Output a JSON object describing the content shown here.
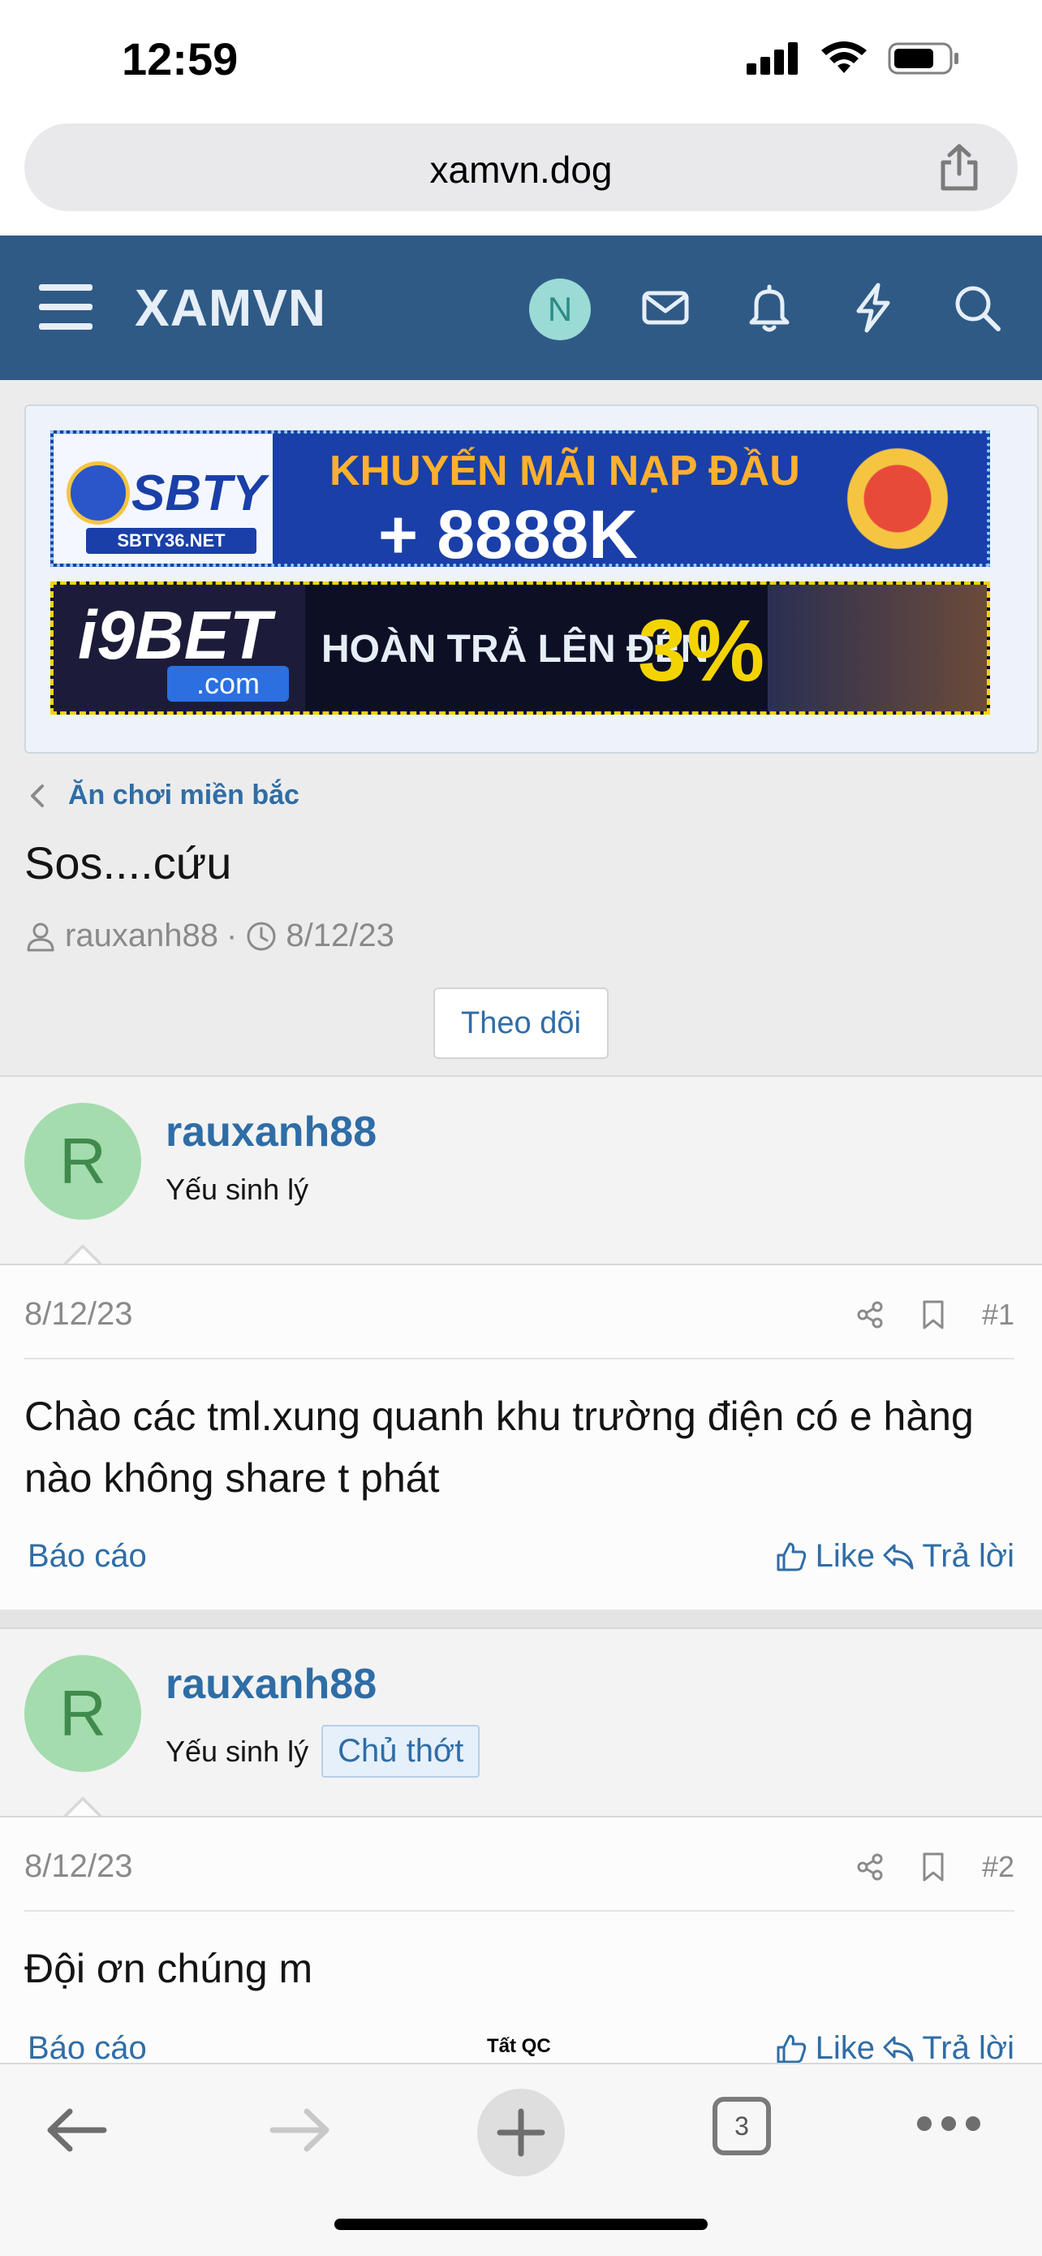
{
  "status_bar": {
    "time": "12:59"
  },
  "browser": {
    "url": "xamvn.dog"
  },
  "site_header": {
    "logo": "XAMVN",
    "user_initial": "N"
  },
  "ads": [
    {
      "brand": "SBTY",
      "brand_sub": "SBTY36.NET",
      "line1": "KHUYẾN MÃI NẠP ĐẦU",
      "line2": "+ 8888K"
    },
    {
      "brand": "i9BET",
      "brand_sub": ".com",
      "line1": "HOÀN TRẢ LÊN ĐẾN",
      "line2": "3%"
    }
  ],
  "breadcrumb": {
    "label": "Ăn chơi miền bắc"
  },
  "thread": {
    "title": "Sos....cứu",
    "author": "rauxanh88",
    "separator": "·",
    "date": "8/12/23",
    "follow_label": "Theo dõi"
  },
  "posts": [
    {
      "avatar_letter": "R",
      "username": "rauxanh88",
      "rank": "Yếu sinh lý",
      "date": "8/12/23",
      "number": "#1",
      "text": "Chào các tml.xung quanh khu trường điện có e hàng nào không share t phát",
      "report_label": "Báo cáo",
      "like_label": "Like",
      "reply_label": "Trả lời"
    },
    {
      "avatar_letter": "R",
      "username": "rauxanh88",
      "rank": "Yếu sinh lý",
      "badge": "Chủ thớt",
      "date": "8/12/23",
      "number": "#2",
      "text": "Đội ơn chúng m",
      "report_label": "Báo cáo",
      "like_label": "Like",
      "reply_label": "Trả lời"
    }
  ],
  "bottom_bar": {
    "ad_label": "Tất QC",
    "tab_count": "3"
  },
  "colors": {
    "header_bg": "#2f5a86",
    "link": "#2f6da6",
    "avatar_green": "#a4dcae",
    "avatar_teal": "#9adbd6"
  }
}
